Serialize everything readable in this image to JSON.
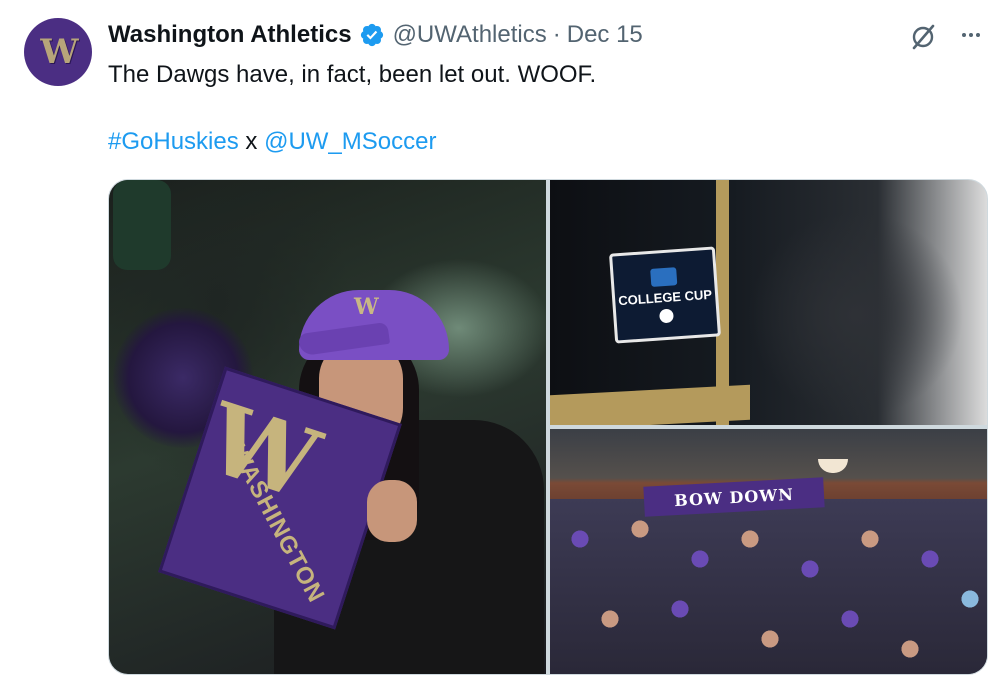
{
  "tweet": {
    "avatar_letter": "W",
    "author_name": "Washington Athletics",
    "handle": "@UWAthletics",
    "separator": "·",
    "date": "Dec 15",
    "text": "The Dawgs have, in fact, been let out. WOOF.",
    "hashtag": "#GoHuskies",
    "connector": "x",
    "mention": "@UW_MSoccer"
  },
  "media": {
    "patch_label": "COLLEGE CUP",
    "banner_text": "BOW DOWN",
    "scarf_letter": "W",
    "scarf_text": "WASHINGTON",
    "cap_logo": "W"
  },
  "colors": {
    "brand_purple": "#4b2e83",
    "brand_gold": "#b7a57a",
    "link": "#1d9bf0",
    "verified": "#1d9bf0",
    "secondary_text": "#536471"
  },
  "icons": [
    "verified-badge-icon",
    "grok-icon",
    "more-options-icon"
  ]
}
